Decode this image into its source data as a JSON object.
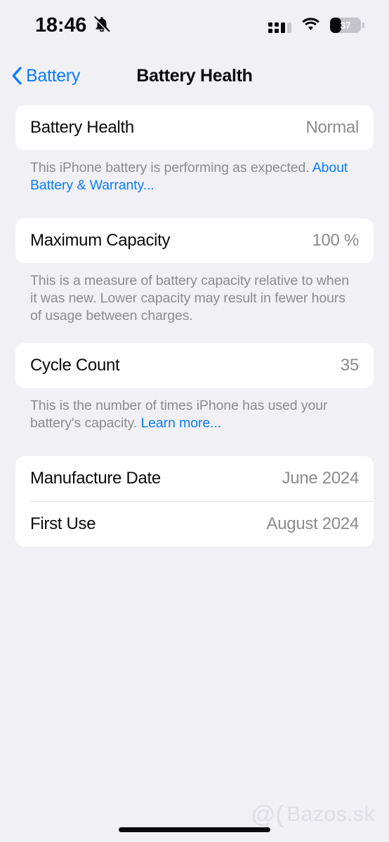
{
  "status_bar": {
    "time": "18:46",
    "silent_icon": "bell-slash-icon",
    "cellular_icon": "cellular-bars-icon",
    "wifi_icon": "wifi-icon",
    "battery_percent": "37",
    "battery_level": 37,
    "battery_icon": "battery-icon"
  },
  "nav": {
    "back_label": "Battery",
    "back_icon": "chevron-left-icon",
    "title": "Battery Health"
  },
  "sections": {
    "health": {
      "label": "Battery Health",
      "value": "Normal",
      "footnote_text": "This iPhone battery is performing as expected. ",
      "footnote_link": "About Battery & Warranty..."
    },
    "capacity": {
      "label": "Maximum Capacity",
      "value": "100 %",
      "footnote_text": "This is a measure of battery capacity relative to when it was new. Lower capacity may result in fewer hours of usage between charges."
    },
    "cycles": {
      "label": "Cycle Count",
      "value": "35",
      "footnote_text": "This is the number of times iPhone has used your battery's capacity. ",
      "footnote_link": "Learn more..."
    },
    "dates": {
      "manufacture_label": "Manufacture Date",
      "manufacture_value": "June 2024",
      "first_use_label": "First Use",
      "first_use_value": "August 2024"
    }
  },
  "watermark": {
    "at": "@(",
    "text": "Bazos.sk"
  },
  "colors": {
    "background": "#f1f1f5",
    "card": "#ffffff",
    "accent_blue": "#0a7cff",
    "secondary_text": "#8b8b90",
    "primary_text": "#0b0b0d"
  }
}
